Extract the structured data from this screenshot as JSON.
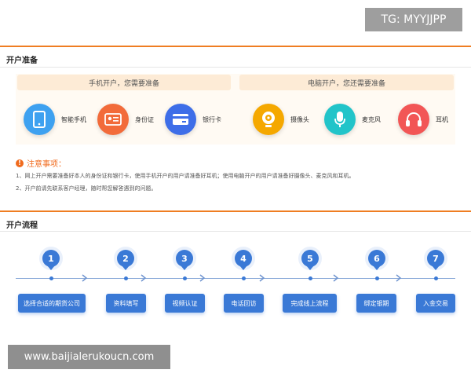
{
  "watermark_top": "TG: MYYJJPP",
  "watermark_bottom": "www.baijialerukoucn.com",
  "colors": {
    "accent_orange": "#ef7d22",
    "step_blue": "#3a79d6"
  },
  "prep": {
    "title": "开户准备",
    "mobile_header": "手机开户，您需要准备",
    "pc_header": "电脑开户，您还需要准备",
    "mobile_items": [
      {
        "label": "智能手机",
        "icon": "smartphone-icon",
        "color": "#3ea1f0"
      },
      {
        "label": "身份证",
        "icon": "id-card-icon",
        "color": "#f26b3a"
      },
      {
        "label": "银行卡",
        "icon": "bank-card-icon",
        "color": "#3e6ee8"
      }
    ],
    "pc_items": [
      {
        "label": "摄像头",
        "icon": "webcam-icon",
        "color": "#f5a800"
      },
      {
        "label": "麦克风",
        "icon": "microphone-icon",
        "color": "#22c4c9"
      },
      {
        "label": "耳机",
        "icon": "headphones-icon",
        "color": "#f25656"
      }
    ],
    "notes_title": "注意事项：",
    "notes": [
      "1、网上开户需要准备好本人的身份证和银行卡，使用手机开户的用户请准备好耳机；使用电脑开户的用户请准备好摄像头、麦克风和耳机。",
      "2、开户前请先联系客户经理，随时帮您解答遇到的问题。"
    ]
  },
  "flow": {
    "title": "开户流程",
    "steps": [
      {
        "num": "1",
        "label": "选择合适的期货公司"
      },
      {
        "num": "2",
        "label": "资料填写"
      },
      {
        "num": "3",
        "label": "视频认证"
      },
      {
        "num": "4",
        "label": "电话回访"
      },
      {
        "num": "5",
        "label": "完成线上流程"
      },
      {
        "num": "6",
        "label": "绑定银期"
      },
      {
        "num": "7",
        "label": "入金交易"
      }
    ]
  }
}
